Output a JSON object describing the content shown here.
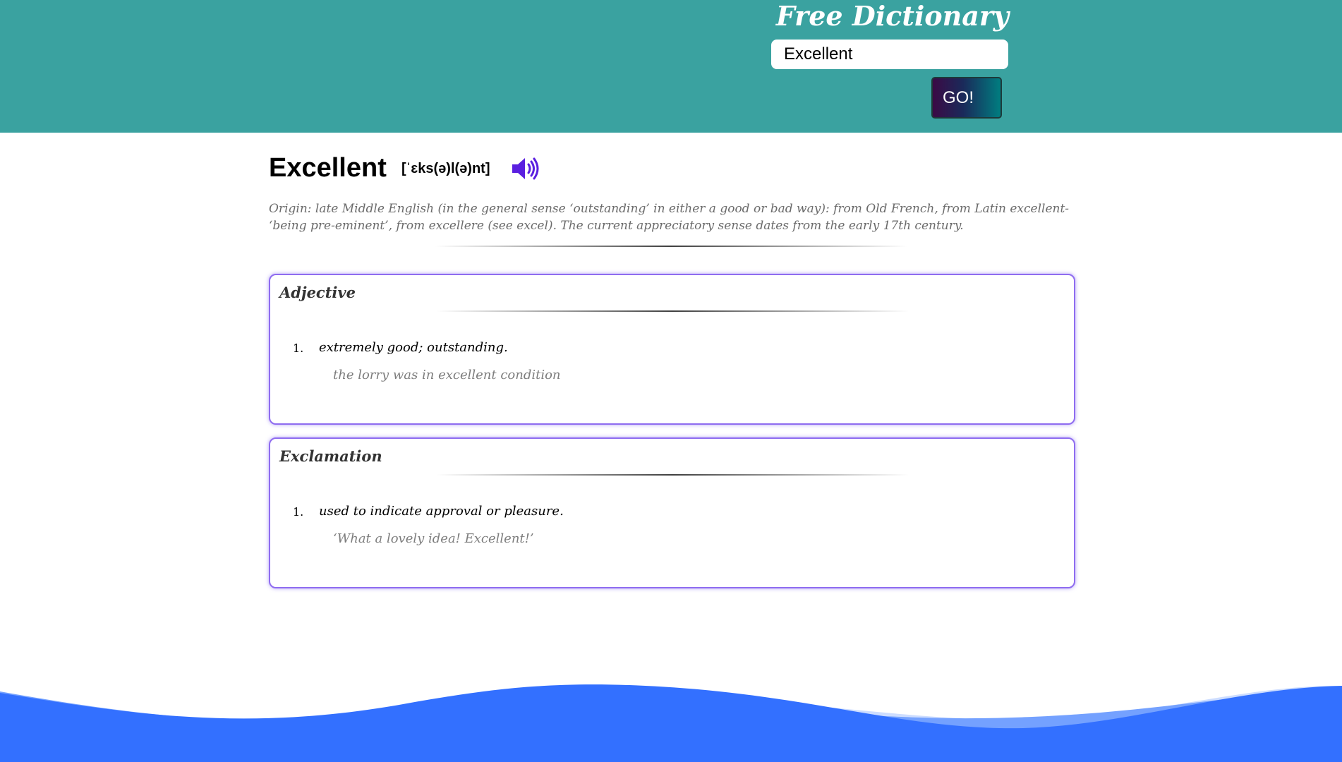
{
  "header": {
    "brand": "Free Dictionary",
    "search_value": "Excellent",
    "go_label": "GO!"
  },
  "entry": {
    "word": "Excellent",
    "phonetic": "[ˈɛks(ə)l(ə)nt]",
    "origin": "Origin: late Middle English (in the general sense ‘outstanding’ in either a good or bad way): from Old French, from Latin excellent- ‘being pre-eminent’, from excellere (see excel). The current appreciatory sense dates from the early 17th century.",
    "meanings": [
      {
        "part_of_speech": "Adjective",
        "definitions": [
          {
            "number": "1.",
            "definition": "extremely good; outstanding.",
            "example": "the lorry was in excellent condition"
          }
        ]
      },
      {
        "part_of_speech": "Exclamation",
        "definitions": [
          {
            "number": "1.",
            "definition": "used to indicate approval or pleasure.",
            "example": "‘What a lovely idea! Excellent!’"
          }
        ]
      }
    ]
  },
  "icons": {
    "audio": "speaker-volume-icon"
  },
  "colors": {
    "header_bg": "#3aa2a0",
    "card_border": "#8f6cf0",
    "speaker": "#5a1fe0",
    "wave_dark": "#3370ff",
    "wave_mid": "#74a1ff",
    "wave_light": "#cdddff"
  }
}
